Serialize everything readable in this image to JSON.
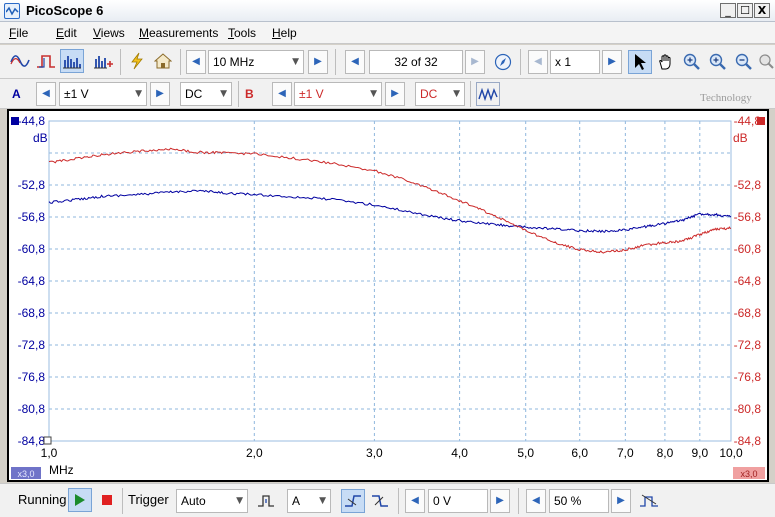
{
  "window": {
    "title": "PicoScope 6",
    "controls": [
      "_",
      "☐",
      "X"
    ]
  },
  "menu": [
    {
      "label": "File",
      "u": "F",
      "rest": "ile"
    },
    {
      "label": "Edit",
      "u": "E",
      "rest": "dit"
    },
    {
      "label": "Views",
      "u": "V",
      "rest": "iews"
    },
    {
      "label": "Measurements",
      "u": "M",
      "rest": "easurements"
    },
    {
      "label": "Tools",
      "u": "T",
      "rest": "ools"
    },
    {
      "label": "Help",
      "u": "H",
      "rest": "elp"
    }
  ],
  "toolbar": {
    "frequency_range": "10 MHz",
    "buffer_position": "32 of 32",
    "zoom": "x 1"
  },
  "channels": {
    "a": {
      "letter": "A",
      "range": "±1 V",
      "coupling": "DC",
      "color": "#0000a0"
    },
    "b": {
      "letter": "B",
      "range": "±1 V",
      "coupling": "DC",
      "color": "#cc2a2a"
    }
  },
  "logo_text": "Technology",
  "axis": {
    "left_unit": "dB",
    "right_unit": "dB",
    "x_unit": "MHz",
    "left_scale_badge": "x3,0",
    "right_scale_badge": "x3,0"
  },
  "chart_data": {
    "type": "line",
    "x_scale": "log",
    "xlim": [
      1.0,
      10.0
    ],
    "ylim": [
      -84.8,
      -44.8
    ],
    "x_ticks": [
      1.0,
      2.0,
      3.0,
      4.0,
      5.0,
      6.0,
      7.0,
      8.0,
      9.0,
      10.0
    ],
    "x_tick_labels": [
      "1,0",
      "2,0",
      "3,0",
      "4,0",
      "5,0",
      "6,0",
      "7,0",
      "8,0",
      "9,0",
      "10,0"
    ],
    "y_ticks": [
      -44.8,
      -48.8,
      -52.8,
      -56.8,
      -60.8,
      -64.8,
      -68.8,
      -72.8,
      -76.8,
      -80.8,
      -84.8
    ],
    "y_tick_labels": [
      "-44,8",
      "",
      "-52,8",
      "-56,8",
      "-60,8",
      "-64,8",
      "-68,8",
      "-72,8",
      "-76,8",
      "-80,8",
      "-84,8"
    ],
    "grid": true,
    "series": [
      {
        "channel": "A",
        "color": "#0000a0",
        "x": [
          1.0,
          1.1,
          1.2,
          1.35,
          1.5,
          1.65,
          1.8,
          2.0,
          2.3,
          2.6,
          3.0,
          3.4,
          3.8,
          4.2,
          4.6,
          5.0,
          5.5,
          6.0,
          6.5,
          7.0,
          7.5,
          8.0,
          8.5,
          9.0,
          9.5,
          10.0
        ],
        "values": [
          -55.0,
          -54.6,
          -54.2,
          -54.0,
          -53.7,
          -53.5,
          -53.8,
          -54.0,
          -54.3,
          -54.6,
          -55.3,
          -56.2,
          -57.0,
          -57.5,
          -57.8,
          -58.1,
          -58.3,
          -58.5,
          -58.6,
          -58.4,
          -58.0,
          -57.6,
          -57.2,
          -56.4,
          -56.5,
          -56.8
        ]
      },
      {
        "channel": "B",
        "color": "#cc2a2a",
        "x": [
          1.0,
          1.1,
          1.2,
          1.35,
          1.5,
          1.65,
          1.8,
          2.0,
          2.3,
          2.6,
          3.0,
          3.4,
          3.8,
          4.2,
          4.6,
          5.0,
          5.5,
          6.0,
          6.5,
          7.0,
          7.5,
          8.0,
          8.5,
          9.0,
          9.5,
          10.0
        ],
        "values": [
          -50.0,
          -49.5,
          -49.0,
          -48.6,
          -48.3,
          -48.7,
          -48.8,
          -48.9,
          -49.5,
          -50.1,
          -51.0,
          -52.4,
          -54.0,
          -55.5,
          -57.0,
          -58.5,
          -60.0,
          -60.9,
          -61.2,
          -60.9,
          -60.3,
          -60.0,
          -59.8,
          -59.0,
          -58.3,
          -58.2
        ]
      }
    ]
  },
  "status": {
    "run_state": "Running",
    "trigger_label": "Trigger",
    "trigger_mode": "Auto",
    "trigger_channel": "A",
    "trigger_level": "0 V",
    "pre_trigger": "50 %"
  }
}
